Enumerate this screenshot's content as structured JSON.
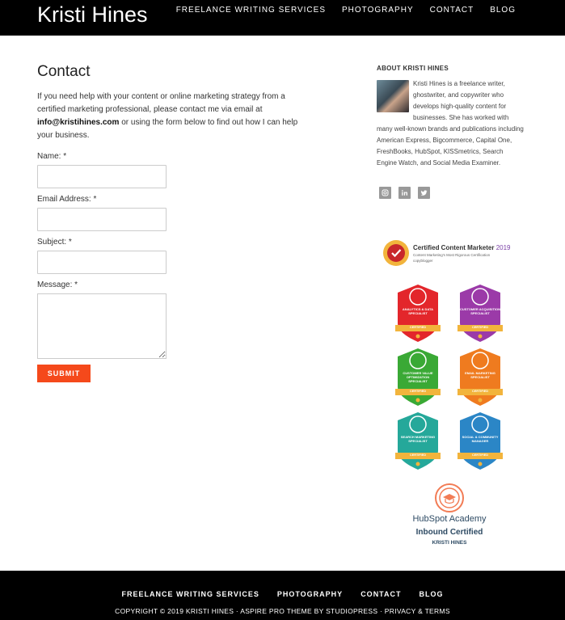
{
  "header": {
    "site_title": "Kristi Hines",
    "nav": [
      "FREELANCE WRITING SERVICES",
      "PHOTOGRAPHY",
      "CONTACT",
      "BLOG"
    ]
  },
  "main": {
    "title": "Contact",
    "intro_part1": "If you need help with your content or online marketing strategy from a certified marketing professional, please contact me via email at",
    "email": "info@kristihines.com",
    "intro_part2": "or using the form below to find out how I can help your business.",
    "form": {
      "name_label": "Name: *",
      "email_label": "Email Address: *",
      "subject_label": "Subject: *",
      "message_label": "Message: *",
      "name_value": "",
      "email_value": "",
      "subject_value": "",
      "message_value": "",
      "submit_label": "SUBMIT"
    }
  },
  "sidebar": {
    "about_title": "ABOUT KRISTI HINES",
    "about_text": "Kristi Hines is a freelance writer, ghostwriter, and copywriter who develops high-quality content for businesses. She has worked with many well-known brands and publications including American Express, Bigcommerce, Capital One, FreshBooks, HubSpot, KISSmetrics, Search Engine Watch, and Social Media Examiner.",
    "social_icons": [
      "instagram-icon",
      "linkedin-icon",
      "twitter-icon"
    ],
    "ccm": {
      "title": "Certified Content Marketer",
      "year": "2019",
      "subtitle": "Content Marketing's Most Rigorous Certification",
      "brand": "copyblogger"
    },
    "badges": [
      {
        "label": "ANALYTICS & DATA SPECIALIST",
        "cert": "CERTIFIED",
        "color": "#e3262b"
      },
      {
        "label": "CUSTOMER ACQUISITION SPECIALIST",
        "cert": "CERTIFIED",
        "color": "#9b3aa8"
      },
      {
        "label": "CUSTOMER VALUE OPTIMIZATION SPECIALIST",
        "cert": "CERTIFIED",
        "color": "#3aa935"
      },
      {
        "label": "EMAIL MARKETING SPECIALIST",
        "cert": "CERTIFIED",
        "color": "#ef7b1f"
      },
      {
        "label": "SEARCH MARKETING SPECIALIST",
        "cert": "CERTIFIED",
        "color": "#25a89a"
      },
      {
        "label": "SOCIAL & COMMUNITY MANAGER",
        "cert": "CERTIFIED",
        "color": "#2b86c6"
      }
    ],
    "hubspot": {
      "logo_text": "HubSpot Academy",
      "inbound": "Inbound Certified",
      "name": "KRISTI HINES"
    }
  },
  "footer": {
    "nav": [
      "FREELANCE WRITING SERVICES",
      "PHOTOGRAPHY",
      "CONTACT",
      "BLOG"
    ],
    "copyright_prefix": "COPYRIGHT © 2019 KRISTI HINES ·",
    "theme_link": "ASPIRE PRO THEME",
    "by": "BY",
    "studiopress_link": "STUDIOPRESS",
    "sep": "·",
    "privacy_link": "PRIVACY & TERMS"
  },
  "colors": {
    "header_bg": "#000000",
    "accent": "#f5491b",
    "social_icon_bg": "#999999"
  }
}
